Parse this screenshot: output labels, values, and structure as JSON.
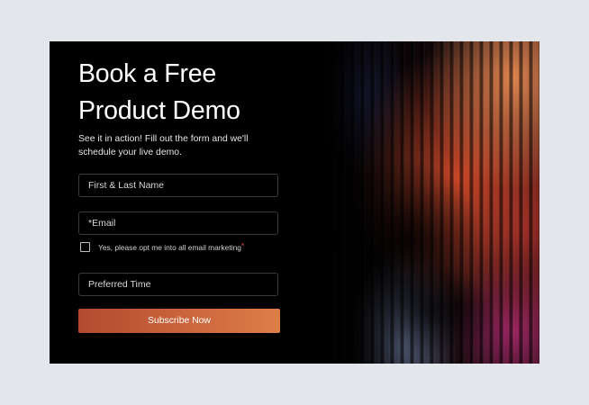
{
  "form": {
    "title_line1": "Book a Free",
    "title_line2": "Product Demo",
    "subtitle_line1": "See it in action! Fill out the form and we'll",
    "subtitle_line2": "schedule your live demo.",
    "name_placeholder": "First & Last Name",
    "email_placeholder": "*Email",
    "optin_label": "Yes, please opt me into all email marketing",
    "optin_required_mark": "*",
    "optin_checked": false,
    "time_placeholder": "Preferred Time",
    "submit_label": "Subscribe Now"
  },
  "colors": {
    "page_background": "#e3e7ec",
    "card_background": "#000000",
    "button_gradient_start": "#b24a2e",
    "button_gradient_end": "#dd7e48",
    "required_mark": "#e0463a"
  }
}
